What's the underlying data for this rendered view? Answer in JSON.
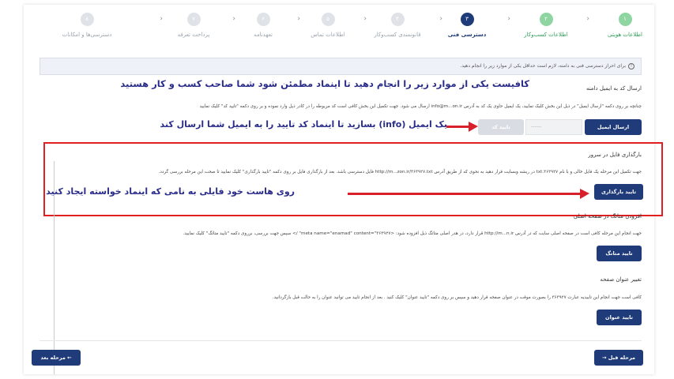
{
  "steps": [
    {
      "num": "۱",
      "label": "اطلاعات هویتی",
      "state": "done"
    },
    {
      "num": "۲",
      "label": "اطلاعات کسب‌و‌کار",
      "state": "done"
    },
    {
      "num": "۳",
      "label": "دسترسی فنی",
      "state": "current"
    },
    {
      "num": "۴",
      "label": "قانونمندی کسب‌و‌کار",
      "state": "todo"
    },
    {
      "num": "۵",
      "label": "اطلاعات تماس",
      "state": "todo"
    },
    {
      "num": "۶",
      "label": "تعهدنامه",
      "state": "todo"
    },
    {
      "num": "۷",
      "label": "پرداخت تعرفه",
      "state": "todo"
    },
    {
      "num": "۸",
      "label": "دسترسی‌ها و امکانات",
      "state": "todo"
    }
  ],
  "alert": "برای احراز دسترسی فنی به دامنه، لازم است حداقل یکی از موارد زیر را انجام دهید.",
  "annotations": {
    "top": "کافیست یکی از موارد زیر را انجام دهید تا اینماد مطمئن شود شما صاحب کسب و کار هستید",
    "email": "یک ایمیل (info) بسازید تا اینماد کد تایید را به ایمیل شما ارسال کند",
    "file": "روی هاست خود فایلی به نامی که اینماد خواسته ایجاد کنید"
  },
  "email_section": {
    "title": "ارسال کد به ایمیل دامنه",
    "desc": "چنانچه بر روی دکمه \"ارسال ایمیل\" در ذیل این بخش کلیک نمایید، یک ایمیل حاوی یک کد به آدرس info@m...on.ir ارسال می شود. جهت تکمیل این بخش کافی است کد مربوطه را در کادر ذیل وارد نموده و بر روی دکمه \"تایید کد\" کلیک نمایید",
    "send_label": "ارسال ایمیل",
    "code_placeholder": "------",
    "verify_label": "تایید کد"
  },
  "file_section": {
    "title": "بارگذاری فایل در سرور",
    "desc": "جهت تکمیل این مرحله یک فایل خالی و با نام ۳۶۳۹۲۷.txt در ریشه وبسایت قرار دهید به نحوی که از طریق آدرس http://m...zon.ir/۳۶۳۹۲۷.txt فایل دسترسی باشد. بعد از بارگذاری فایل بر روی دکمه \"تایید بارگذاری\" کلیک نمایید تا صحت این مرحله بررسی گردد.",
    "button_label": "تایید بارگذاری"
  },
  "meta_section": {
    "title": "افزودن متاتگ در صفحه اصلی",
    "desc": "جهت انجام این مرحله کافی است در صفحه اصلی سایت که در آدرس http://m...n.ir قرار دارد، در هدر اصلی متاتگ ذیل افزوده شود: <meta name=\"enamad\" content=\"۳۶۳۹۲۷\" /> سپس جهت بررسی، برروی دکمه \"تایید متاتگ\" کلیک نمایید.",
    "button_label": "تایید متاتگ"
  },
  "title_section": {
    "title": "تغییر عنوان صفحه",
    "desc": "کافی است جهت انجام این تاییدیه عبارت ۳۶۳۹۲۷ را بصورت موقت در عنوان صفحه قرار دهید و سپس بر روی دکمه \"تایید عنوان\" کلیک کنید . بعد از انجام تایید می توانید عنوان را به حالت قبل بازگردانید.",
    "button_label": "تایید عنوان"
  },
  "nav": {
    "prev_label": "مرحله قبل",
    "next_label": "مرحله بعد"
  },
  "colors": {
    "primary": "#1f3b7a",
    "done": "#8ed5a2",
    "annotation": "#2a2c8a",
    "highlight": "#e02020"
  }
}
